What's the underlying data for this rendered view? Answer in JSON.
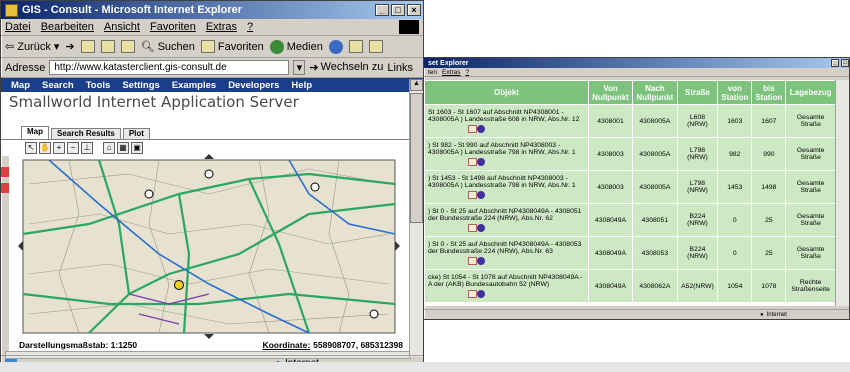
{
  "main_window": {
    "title": "GIS - Consult - Microsoft Internet Explorer",
    "menu": [
      "Datei",
      "Bearbeiten",
      "Ansicht",
      "Favoriten",
      "Extras",
      "?"
    ],
    "toolbar": {
      "back": "Zurück",
      "search": "Suchen",
      "favorites": "Favoriten",
      "media": "Medien"
    },
    "address_label": "Adresse",
    "address_value": "http://www.katasterclient.gis-consult.de",
    "go_label": "Wechseln zu",
    "links_label": "Links",
    "app_nav": [
      "Map",
      "Search",
      "Tools",
      "Settings",
      "Examples",
      "Developers",
      "Help"
    ],
    "app_title": "Smallworld Internet Application Server",
    "tabs": [
      "Map",
      "Search Results",
      "Plot"
    ],
    "scale_label": "Darstellungsmaßstab: 1:1250",
    "coord_label": "Koordinate:",
    "coord_value": "558908707, 685312398",
    "status_zone": "Internet"
  },
  "second_window": {
    "title": "set Explorer",
    "menu": [
      "ten",
      "Extras",
      "?"
    ],
    "status_zone": "Internet",
    "table": {
      "headers": [
        "Objekt",
        "Von Nullpunkt",
        "Nach Nullpunkt",
        "Straße",
        "von Station",
        "bis Station",
        "Lagebezug"
      ],
      "rows": [
        {
          "objekt": "St 1603 - St 1607 auf Abschnitt NP4308001 - 4308005A ) Landesstraße 608 in NRW, Abs.Nr. 12",
          "von_np": "4308001",
          "nach_np": "4308005A",
          "strasse": "L608 (NRW)",
          "von_st": "1603",
          "bis_st": "1607",
          "lage": "Gesamte Straße"
        },
        {
          "objekt": ") St 982 - St 990 auf Abschnitt NP4308003 - 4308005A ) Landesstraße 798 in NRW, Abs.Nr. 1",
          "von_np": "4308003",
          "nach_np": "4308005A",
          "strasse": "L798 (NRW)",
          "von_st": "982",
          "bis_st": "990",
          "lage": "Gesamte Straße"
        },
        {
          "objekt": ") St 1453 - St 1498 auf Abschnitt NP4308003 - 4308005A ) Landesstraße 798 in NRW, Abs.Nr. 1",
          "von_np": "4308003",
          "nach_np": "4308005A",
          "strasse": "L798 (NRW)",
          "von_st": "1453",
          "bis_st": "1498",
          "lage": "Gesamte Straße"
        },
        {
          "objekt": ") St 0 - St 25 auf Abschnitt NP4308049A - 4308051 der Bundesstraße 224 (NRW), Abs.Nr. 62",
          "von_np": "4308049A",
          "nach_np": "4308051",
          "strasse": "B224 (NRW)",
          "von_st": "0",
          "bis_st": "25",
          "lage": "Gesamte Straße"
        },
        {
          "objekt": ") St 0 - St 25 auf Abschnitt NP4308049A - 4308053 der Bundesstraße 224 (NRW), Abs.Nr. 63",
          "von_np": "4308049A",
          "nach_np": "4308053",
          "strasse": "B224 (NRW)",
          "von_st": "0",
          "bis_st": "25",
          "lage": "Gesamte Straße"
        },
        {
          "objekt": "cke) St 1054 - St 1078 auf Abschnitt NP4308049A - A der (AKB) Bundesautobahn 52 (NRW)",
          "von_np": "4308049A",
          "nach_np": "4308062A",
          "strasse": "A52(NRW)",
          "von_st": "1054",
          "bis_st": "1078",
          "lage": "Rechte Straßenseite"
        }
      ]
    }
  },
  "colors": {
    "title_start": "#0a246a",
    "title_end": "#a6caf0",
    "nav_blue": "#1a3e8c",
    "header_green": "#7dc27d",
    "cell_green": "#cde9c4"
  }
}
